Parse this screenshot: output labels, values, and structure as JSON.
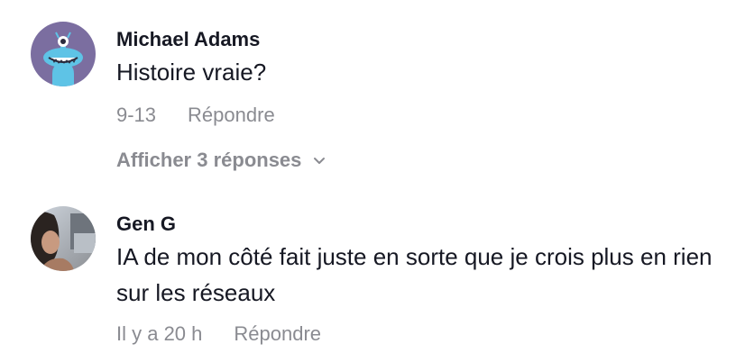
{
  "comments": [
    {
      "author": "Michael Adams",
      "text": "Histoire vraie?",
      "date": "9-13",
      "reply_label": "Répondre",
      "view_replies_label": "Afficher 3 réponses",
      "avatar_icon": "monster-cartoon-icon",
      "avatar_bg": "#7b6ea0"
    },
    {
      "author": "Gen G",
      "text": "IA de mon côté fait juste en sorte que je crois plus en rien sur les réseaux",
      "date": "Il y a 20 h",
      "reply_label": "Répondre",
      "avatar_icon": "user-photo-icon"
    }
  ],
  "colors": {
    "primary_text": "#161823",
    "secondary_text": "#8a8b91"
  }
}
